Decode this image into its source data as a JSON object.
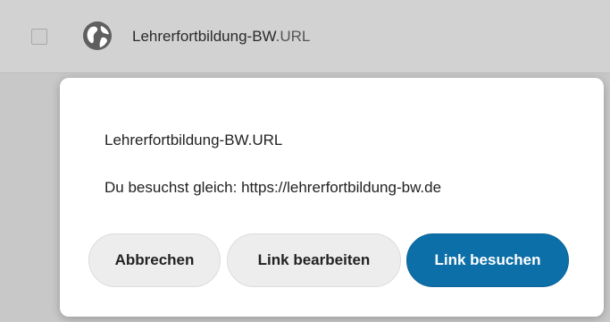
{
  "file_row": {
    "name": "Lehrerfortbildung-BW",
    "extension": ".URL",
    "icon": "globe-icon"
  },
  "dialog": {
    "title": "Lehrerfortbildung-BW.URL",
    "message": "Du besuchst gleich: https://lehrerfortbildung-bw.de",
    "buttons": {
      "cancel": "Abbrechen",
      "edit": "Link bearbeiten",
      "visit": "Link besuchen"
    }
  },
  "colors": {
    "primary": "#0d6fa8",
    "secondary_button": "#ededed",
    "overlay_background": "#c8c8c8"
  }
}
